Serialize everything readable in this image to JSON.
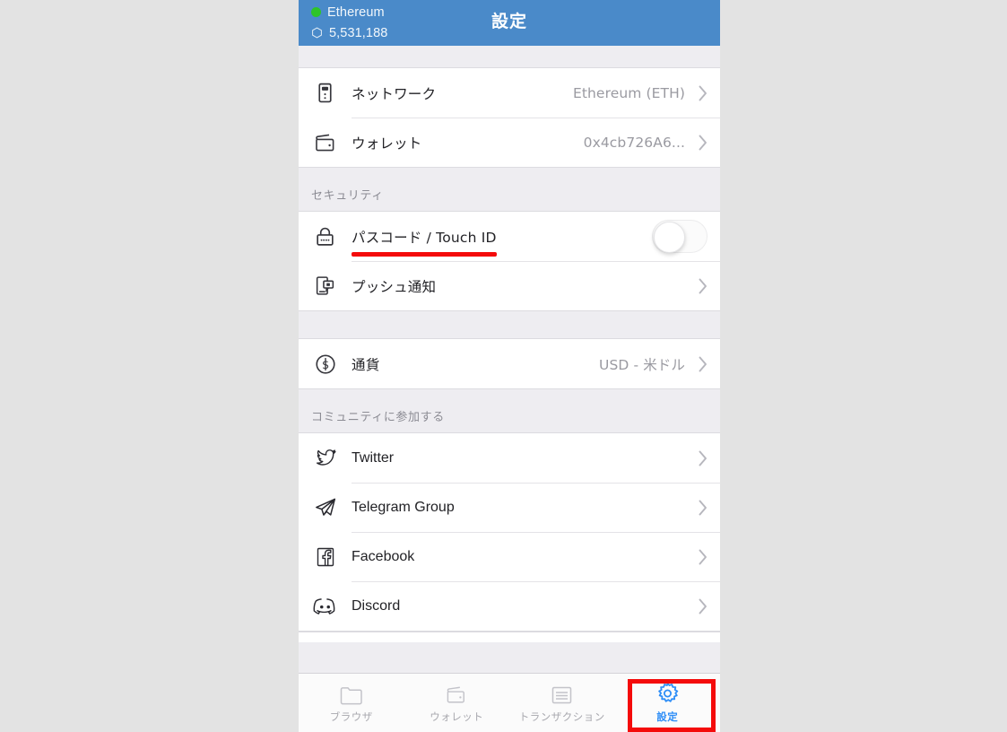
{
  "header": {
    "network_name": "Ethereum",
    "block_number": "5,531,188",
    "title": "設定",
    "bg_color": "#4a8ac9",
    "status_dot_color": "#2ec428",
    "network_icon": "cube-icon",
    "block_icon": "block-cube-icon"
  },
  "sections": [
    {
      "header": "",
      "rows": [
        {
          "icon": "network-server-icon",
          "label": "ネットワーク",
          "value": "Ethereum (ETH)",
          "accessory": "chevron"
        },
        {
          "icon": "wallet-icon",
          "label": "ウォレット",
          "value": "0x4cb726A6...",
          "accessory": "chevron"
        }
      ]
    },
    {
      "header": "セキュリティ",
      "rows": [
        {
          "icon": "lock-passcode-icon",
          "label": "パスコード / Touch ID",
          "value": "",
          "accessory": "toggle",
          "toggle_on": false,
          "highlighted": true
        },
        {
          "icon": "push-notification-icon",
          "label": "プッシュ通知",
          "value": "",
          "accessory": "chevron"
        }
      ]
    },
    {
      "header": "",
      "rows": [
        {
          "icon": "currency-dollar-icon",
          "label": "通貨",
          "value": "USD - 米ドル",
          "accessory": "chevron"
        }
      ]
    },
    {
      "header": "コミュニティに参加する",
      "rows": [
        {
          "icon": "twitter-icon",
          "label": "Twitter",
          "value": "",
          "accessory": "chevron"
        },
        {
          "icon": "telegram-icon",
          "label": "Telegram Group",
          "value": "",
          "accessory": "chevron"
        },
        {
          "icon": "facebook-icon",
          "label": "Facebook",
          "value": "",
          "accessory": "chevron"
        },
        {
          "icon": "discord-icon",
          "label": "Discord",
          "value": "",
          "accessory": "chevron"
        }
      ]
    }
  ],
  "tabbar": {
    "tabs": [
      {
        "icon": "browser-icon",
        "label": "ブラウザ",
        "active": false
      },
      {
        "icon": "wallet-icon",
        "label": "ウォレット",
        "active": false
      },
      {
        "icon": "transactions-list-icon",
        "label": "トランザクション",
        "active": false
      },
      {
        "icon": "gear-icon",
        "label": "設定",
        "active": true
      }
    ],
    "active_color": "#2e8ef7",
    "inactive_color": "#a8a8ae"
  },
  "annotations": {
    "underline_color": "#f40b0b",
    "highlight_box_color": "#f40b0b",
    "underline_target": "パスコード / Touch ID",
    "highlight_box_target": "設定"
  }
}
